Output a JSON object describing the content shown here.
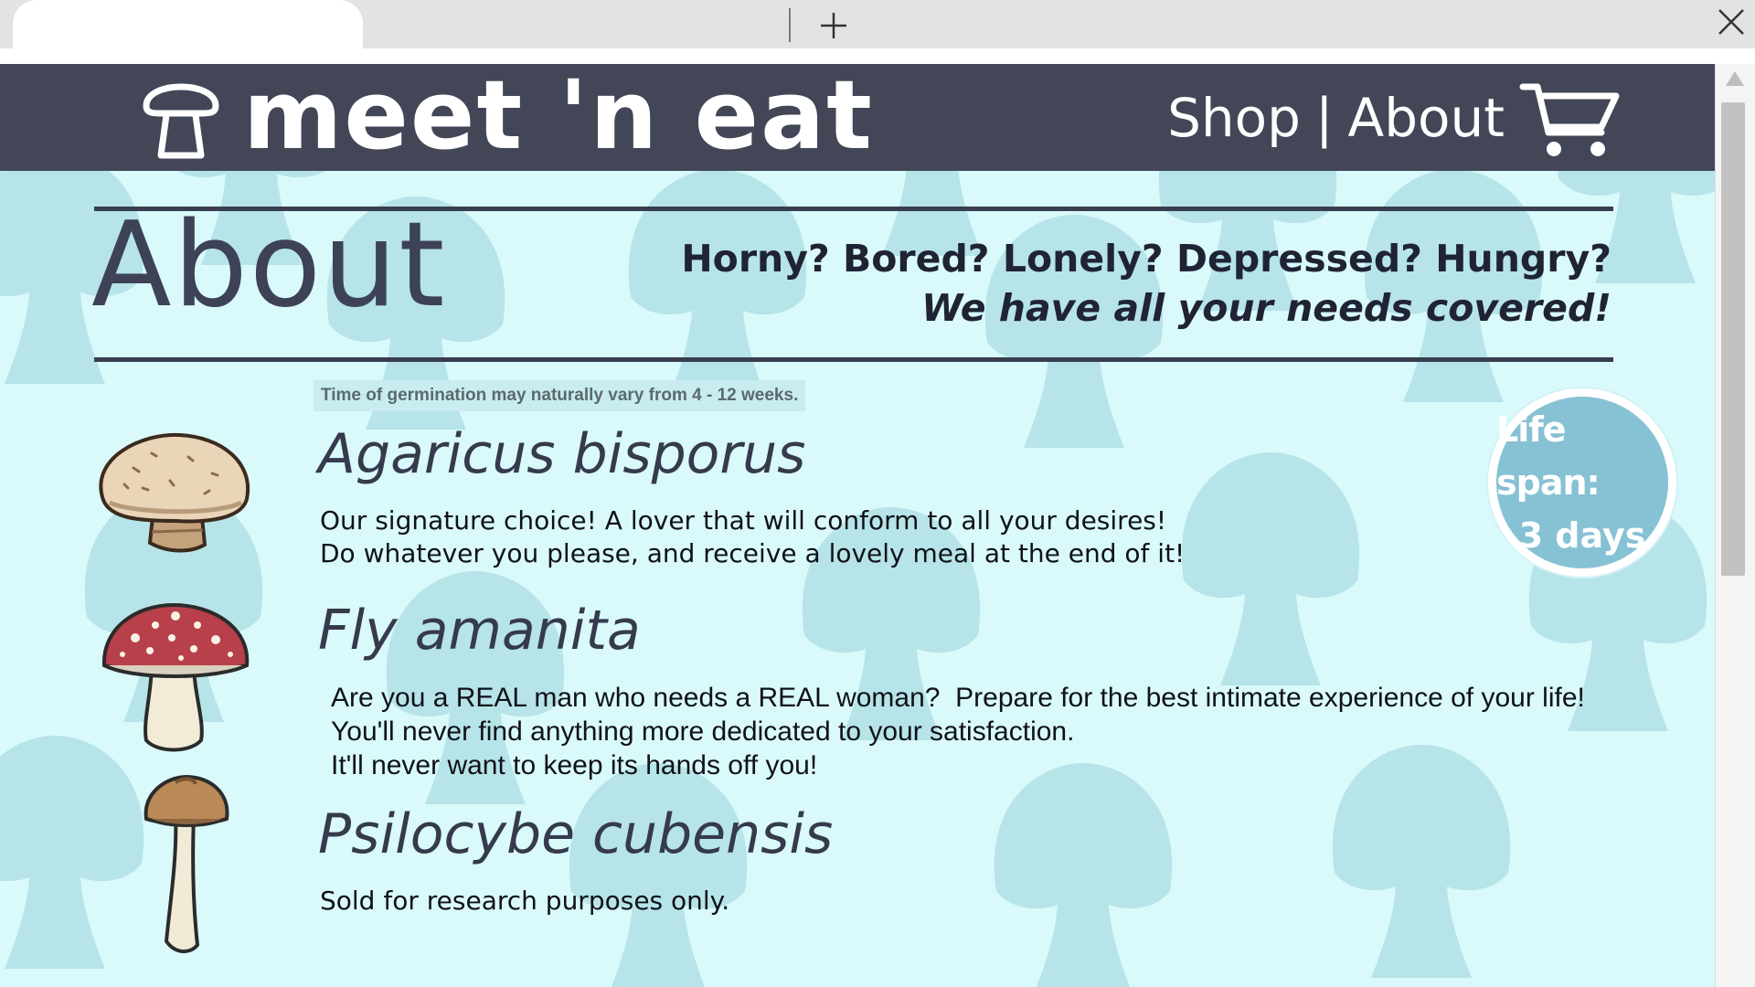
{
  "browser": {
    "new_tab_icon": "plus-icon",
    "close_icon": "close-icon"
  },
  "header": {
    "brand": "meet 'n eat",
    "logo_icon": "mushroom-icon",
    "nav": {
      "shop": "Shop",
      "separator": "|",
      "about": "About"
    },
    "cart_icon": "cart-icon",
    "bg_color": "#424656"
  },
  "page": {
    "title": "About",
    "tagline_line1": "Horny? Bored? Lonely? Depressed? Hungry?",
    "tagline_line2": "We have all your needs covered!",
    "germination_note": "Time of germination may naturally vary from 4 - 12 weeks.",
    "badge_line1": "Life span:",
    "badge_line2": "3 days",
    "bg_color": "#d9f9fb",
    "shape_color": "#b6e4e8"
  },
  "products": [
    {
      "name": "Agaricus bisporus",
      "image": "button-mushroom",
      "lines": [
        "Our signature choice! A lover that will conform to all your desires!",
        "Do whatever you please, and receive a lovely meal at the end of it!"
      ]
    },
    {
      "name": "Fly amanita",
      "image": "fly-agaric-mushroom",
      "lines": [
        "Are you a REAL man who needs a REAL woman?  Prepare for the best intimate experience of your life!",
        "You'll never find anything more dedicated to your satisfaction.",
        "It'll never want to keep its hands off you!"
      ]
    },
    {
      "name": "Psilocybe cubensis",
      "image": "psilocybe-mushroom",
      "lines": [
        "Sold for research purposes only."
      ]
    }
  ]
}
